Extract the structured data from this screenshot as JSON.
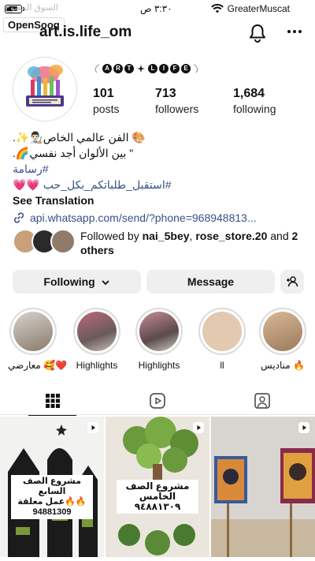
{
  "status": {
    "carrier": "GreaterMuscat",
    "time": "٣:٣٠ ص"
  },
  "watermark": {
    "label": "OpenSooq",
    "arabic": "السوق المفتوح"
  },
  "profile": {
    "username": "art.is.life_om",
    "brand": [
      "A",
      "R",
      "T",
      "L",
      "I",
      "F",
      "E"
    ],
    "posts_count": "101",
    "posts_label": "posts",
    "followers_count": "713",
    "followers_label": "followers",
    "following_count": "1,684",
    "following_label": "following",
    "bio_line1": "🎨 الفن عالمي الخاص👨🏻‍🎨✨.",
    "bio_line2": "\" بين الألوان أجد نفسي🌈.",
    "bio_hashtag1": "#رسامة",
    "bio_hashtag2": "#استقبل_طلباتكم_بكل_حب 💗💗",
    "see_translation": "See Translation",
    "link": "api.whatsapp.com/send/?phone=968948813..."
  },
  "followed_by": {
    "prefix": "Followed by ",
    "user1": "nai_5bey",
    "sep": ", ",
    "user2": "rose_store.20",
    "and": " and ",
    "others": "2 others"
  },
  "actions": {
    "following": "Following",
    "message": "Message"
  },
  "highlights": [
    {
      "label": "معارضي 🥰❤️"
    },
    {
      "label": "Highlights"
    },
    {
      "label": "Highlights"
    },
    {
      "label": "ll"
    },
    {
      "label": "مناديس 🔥"
    }
  ],
  "posts": [
    {
      "caption": "مشروع الصف السابع\nعمل معلقة🔥🔥\n94881309"
    },
    {
      "caption": "مشروع الصف الخامس\n٩٤٨٨١٣٠٩"
    },
    {
      "caption": ""
    }
  ]
}
